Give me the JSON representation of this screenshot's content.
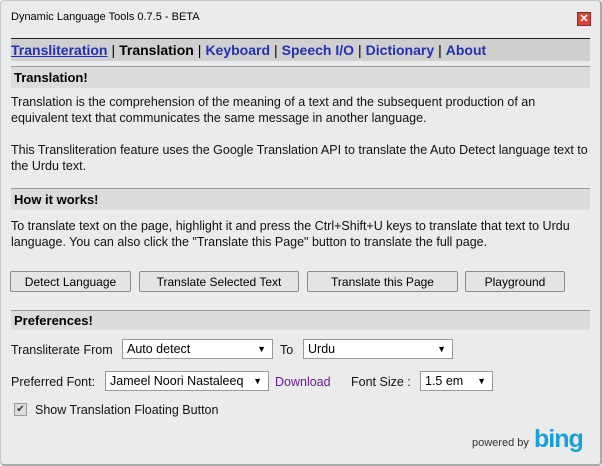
{
  "window": {
    "title": "Dynamic Language Tools 0.7.5 - BETA",
    "close": "✕"
  },
  "nav": {
    "items": [
      "Transliteration",
      "Translation",
      "Keyboard",
      "Speech I/O",
      "Dictionary",
      "About"
    ],
    "sep": "|"
  },
  "sections": {
    "translation": {
      "title": "Translation!",
      "p1": "Translation is the comprehension of the meaning of a text and the subsequent production of an equivalent text that communicates the same message in another language.",
      "p2": "This Transliteration feature uses the Google Translation API to translate the Auto Detect language text to the Urdu text."
    },
    "how": {
      "title": "How it works!",
      "p1": "To translate text on the page, highlight it and press the Ctrl+Shift+U keys to translate that text to Urdu language. You can also click the \"Translate this Page\" button to translate the full page."
    },
    "prefs": {
      "title": "Preferences!"
    }
  },
  "buttons": [
    "Detect Language",
    "Translate Selected Text",
    "Translate this Page",
    "Playground"
  ],
  "prefs": {
    "from_label": "Transliterate From",
    "from_value": "Auto detect",
    "to_label": "To",
    "to_value": "Urdu",
    "font_label": "Preferred Font:",
    "font_value": "Jameel Noori Nastaleeq",
    "download": "Download",
    "size_label": "Font Size :",
    "size_value": "1.5 em",
    "checkbox_label": "Show Translation Floating Button",
    "checkbox_checked": true,
    "check": "✔",
    "arrow": "▼"
  },
  "footer": {
    "powered": "powered by",
    "brand": "bing",
    "brand_color": "#1a9fd6"
  }
}
